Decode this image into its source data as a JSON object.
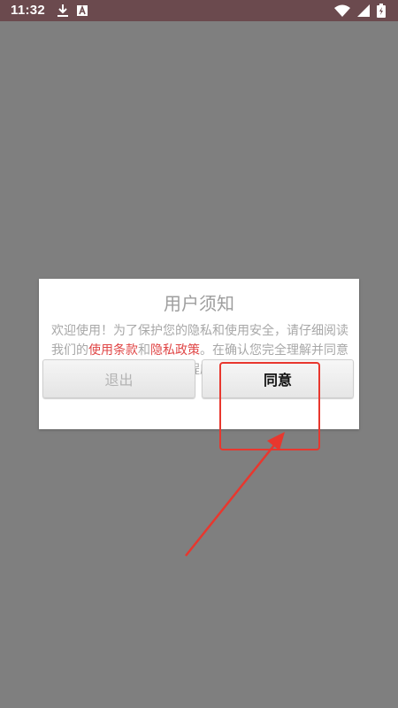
{
  "status_bar": {
    "time": "11:32",
    "icons": [
      "download-icon",
      "app-a-icon",
      "wifi-icon",
      "signal-icon",
      "battery-charging-icon"
    ]
  },
  "dialog": {
    "title": "用户须知",
    "body_part1": "欢迎使用！为了保护您的隐私和使用安全，请仔细阅读我们的",
    "link_terms": "使用条款",
    "body_and": "和",
    "link_privacy": "隐私政策",
    "body_part2": "。在确认您完全理解并同意之前，请不要使用此应用程序。谢谢！",
    "exit_label": "退出",
    "agree_label": "同意"
  },
  "colors": {
    "overlay": "#7f7f7f",
    "status_bar": "#6b4a4e",
    "link": "#e04646",
    "annotation": "#e8372e"
  }
}
